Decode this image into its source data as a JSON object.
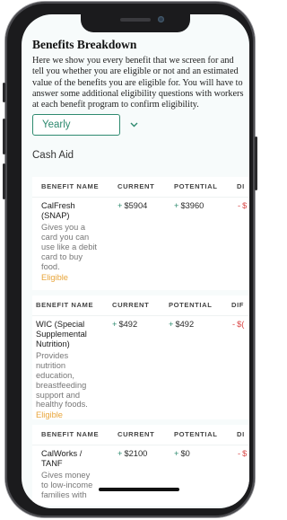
{
  "page": {
    "title": "Benefits Breakdown",
    "intro": "Here we show you every benefit that we screen for and tell you whether you are eligible or not and an estimated value of the benefits you are eligible for. You will have to answer some additional eligibility questions with workers at each benefit program to confirm eligibility.",
    "period_select": {
      "value": "Yearly",
      "icon": "chevron-down-icon"
    },
    "section_title": "Cash Aid"
  },
  "table_headers": {
    "name": "BENEFIT NAME",
    "current": "CURRENT",
    "potential": "POTENTIAL",
    "diff_card1": "DI",
    "diff_card2": "DIF",
    "diff_card3": "DI"
  },
  "benefits": [
    {
      "name": "CalFresh (SNAP)",
      "description": "Gives you a card you can use like a debit card to buy food.",
      "status": "Eligible",
      "current": "$5904",
      "potential": "$3960",
      "diff": "$"
    },
    {
      "name": "WIC (Special Supplemental Nutrition)",
      "description": "Provides nutrition education, breastfeeding support and healthy foods.",
      "status": "Eligible",
      "current": "$492",
      "potential": "$492",
      "diff": "$("
    },
    {
      "name": "CalWorks / TANF",
      "description": "Gives money to low-income families with",
      "status": "",
      "current": "$2100",
      "potential": "$0",
      "diff": "$"
    }
  ],
  "colors": {
    "accent": "#2e8a6f",
    "eligible": "#e8a53a",
    "negative": "#d94444",
    "background": "#f7fbfb"
  }
}
